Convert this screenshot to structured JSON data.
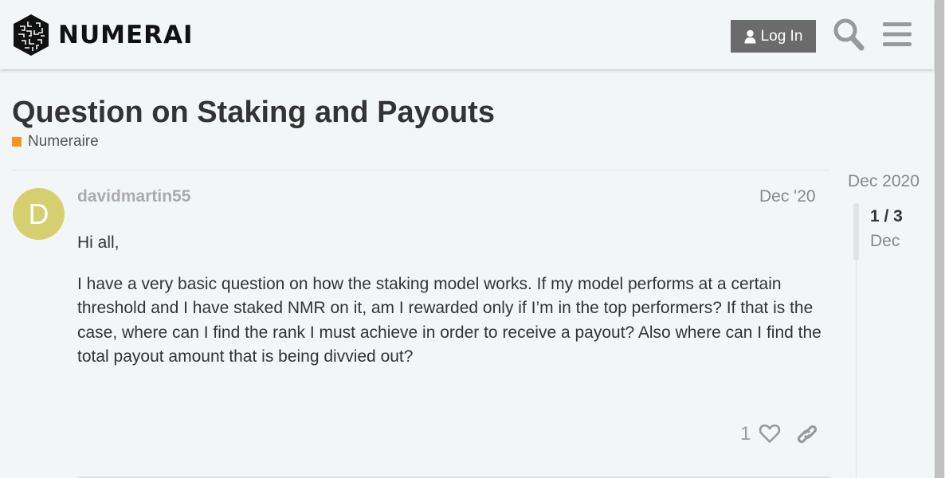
{
  "header": {
    "logo_text": "NUMERAI",
    "login_label": "Log In",
    "icons": {
      "search": "search-icon",
      "menu": "hamburger-menu-icon",
      "user": "user-icon"
    }
  },
  "topic": {
    "title": "Question on Staking and Payouts",
    "category": "Numeraire",
    "category_color": "#f7941d"
  },
  "post": {
    "avatar_letter": "D",
    "avatar_color": "#d6cf6f",
    "username": "davidmartin55",
    "date": "Dec '20",
    "paragraphs": [
      "Hi all,",
      "I have a very basic question on how the staking model works. If my model performs at a certain threshold and I have staked NMR on it, am I rewarded only if I’m in the top performers? If that is the case, where can I find the rank I must achieve in order to receive a payout? Also where can I find the total payout amount that is being divvied out?"
    ],
    "like_count": "1"
  },
  "timeline": {
    "top_date": "Dec 2020",
    "position": "1 / 3",
    "current_date": "Dec"
  }
}
